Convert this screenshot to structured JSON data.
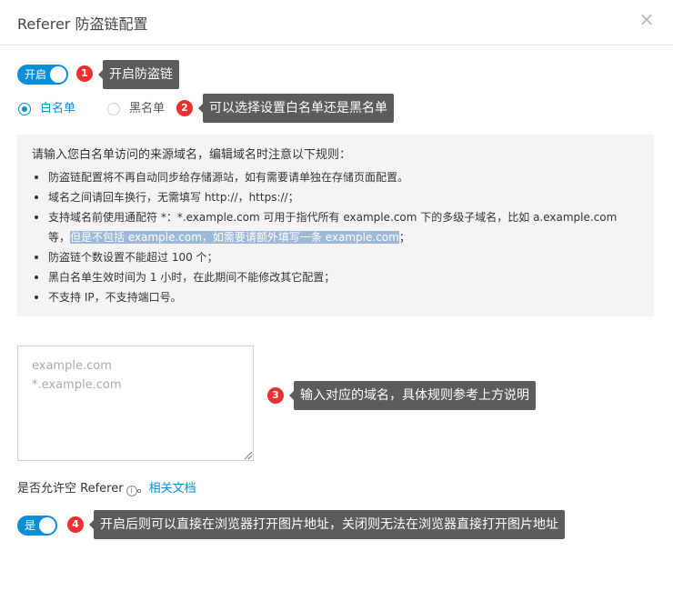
{
  "dialog": {
    "title": "Referer 防盗链配置",
    "close_glyph": "×"
  },
  "enable_switch": {
    "label": "开启",
    "on": true
  },
  "list_type": {
    "options": [
      {
        "label": "白名单",
        "selected": true
      },
      {
        "label": "黑名单",
        "selected": false
      }
    ]
  },
  "rules": {
    "intro": "请输入您白名单访问的来源域名，编辑域名时注意以下规则：",
    "items": [
      "防盗链配置将不再自动同步给存储源站，如有需要请单独在存储页面配置。",
      "域名之间请回车换行，无需填写 http://，https://；",
      "支持域名前使用通配符 *：*.example.com 可用于指代所有 example.com 下的多级子域名，比如 a.example.com 等，",
      "防盗链个数设置不能超过 100 个；",
      "黑白名单生效时间为 1 小时，在此期间不能修改其它配置；",
      "不支持 IP，不支持端口号。"
    ],
    "highlight": "但是不包括 example.com，如需要请额外填写一条 example.com",
    "highlight_tail": "；"
  },
  "domain_input": {
    "value": "",
    "placeholder": "example.com\n*.example.com"
  },
  "allow_empty": {
    "label": "是否允许空 Referer",
    "info_icon": "info-icon",
    "separator": "。",
    "doc_link": "相关文档",
    "switch_label": "是",
    "on": true
  },
  "annotations": [
    {
      "number": "1",
      "text": "开启防盗链"
    },
    {
      "number": "2",
      "text": "可以选择设置白名单还是黑名单"
    },
    {
      "number": "3",
      "text": "输入对应的域名，具体规则参考上方说明"
    },
    {
      "number": "4",
      "text": "开启后则可以直接在浏览器打开图片地址，关闭则无法在浏览器直接打开图片地址"
    }
  ],
  "colors": {
    "accent": "#0a8fd7",
    "marker": "#ee2f2f",
    "tooltip": "#5c5c5c",
    "rules_bg": "#f4f4f4",
    "highlight": "#9db8d8"
  }
}
